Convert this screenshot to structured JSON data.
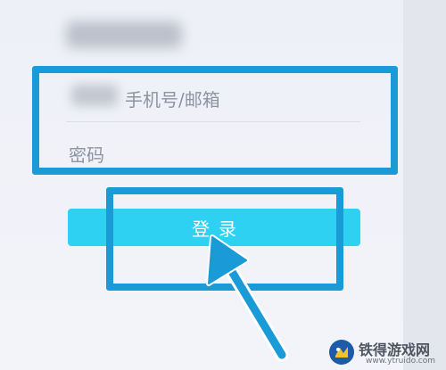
{
  "colors": {
    "accent": "#2ed1f2",
    "highlight": "#1a9ad6",
    "placeholder_text": "#8d93a1",
    "background": "#eef0f7"
  },
  "form": {
    "account_placeholder": "手机号/邮箱",
    "password_placeholder": "密码",
    "login_label": "登录"
  },
  "watermark": {
    "name": "铁得游戏网",
    "url": "www.ytruido.com"
  },
  "icons": [
    "pointer-arrow-icon",
    "watermark-logo-icon"
  ]
}
